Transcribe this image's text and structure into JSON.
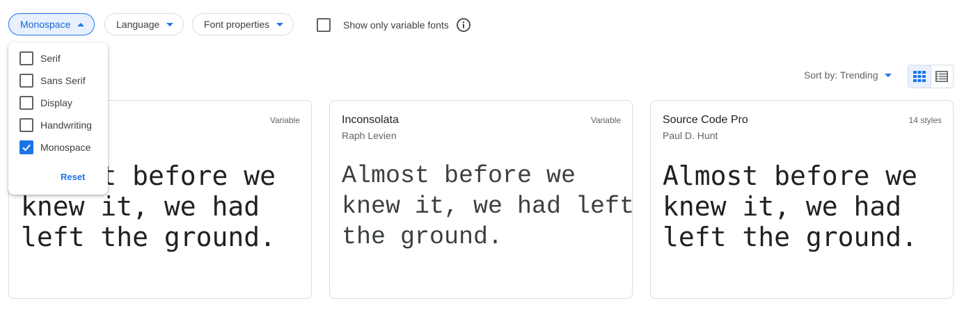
{
  "filters": {
    "category_label": "Monospace",
    "language_label": "Language",
    "font_properties_label": "Font properties",
    "variable_only_label": "Show only variable fonts"
  },
  "sort": {
    "label": "Sort by: Trending"
  },
  "category_menu": {
    "options": [
      {
        "label": "Serif",
        "checked": false
      },
      {
        "label": "Sans Serif",
        "checked": false
      },
      {
        "label": "Display",
        "checked": false
      },
      {
        "label": "Handwriting",
        "checked": false
      },
      {
        "label": "Monospace",
        "checked": true
      }
    ],
    "reset_label": "Reset"
  },
  "cards": [
    {
      "name": "",
      "author": "",
      "tag": "Variable",
      "sample": "Almost before we\nknew it, we had\nleft the ground."
    },
    {
      "name": "Inconsolata",
      "author": "Raph Levien",
      "tag": "Variable",
      "sample": "Almost before we\nknew it, we had left\nthe ground."
    },
    {
      "name": "Source Code Pro",
      "author": "Paul D. Hunt",
      "tag": "14 styles",
      "sample": "Almost before we\nknew it, we had\nleft the ground."
    }
  ],
  "colors": {
    "accent": "#1a73e8",
    "active_chip_bg": "#e8f0fe",
    "border": "#dadce0"
  }
}
